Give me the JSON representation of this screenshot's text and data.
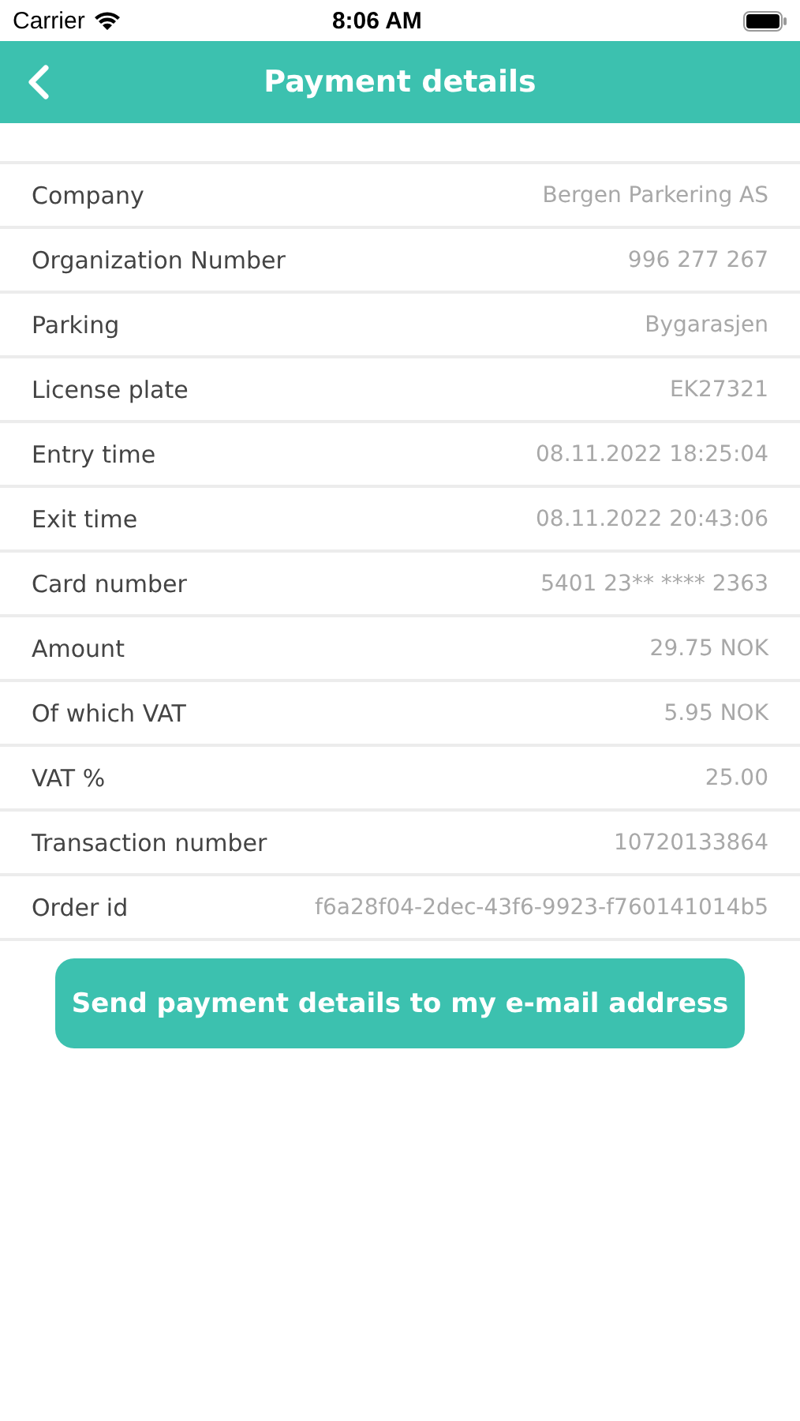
{
  "status_bar": {
    "carrier": "Carrier",
    "time": "8:06 AM"
  },
  "header": {
    "title": "Payment details"
  },
  "details": [
    {
      "label": "Company",
      "value": "Bergen Parkering AS"
    },
    {
      "label": "Organization Number",
      "value": "996 277 267"
    },
    {
      "label": "Parking",
      "value": "Bygarasjen"
    },
    {
      "label": "License plate",
      "value": "EK27321"
    },
    {
      "label": "Entry time",
      "value": "08.11.2022 18:25:04"
    },
    {
      "label": "Exit time",
      "value": "08.11.2022 20:43:06"
    },
    {
      "label": "Card number",
      "value": "5401 23** **** 2363"
    },
    {
      "label": "Amount",
      "value": "29.75 NOK"
    },
    {
      "label": "Of which VAT",
      "value": "5.95 NOK"
    },
    {
      "label": "VAT %",
      "value": "25.00"
    },
    {
      "label": "Transaction number",
      "value": "10720133864"
    },
    {
      "label": "Order id",
      "value": "f6a28f04-2dec-43f6-9923-f760141014b5"
    }
  ],
  "send_button": "Send payment details to my e-mail address"
}
